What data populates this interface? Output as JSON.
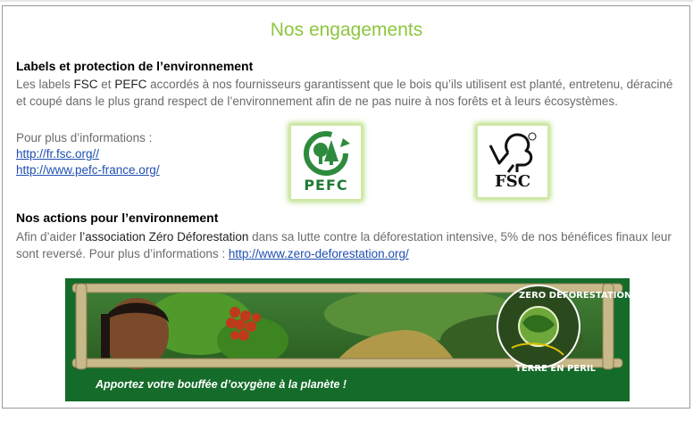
{
  "title": "Nos engagements",
  "section1": {
    "heading": "Labels et protection de l’environnement",
    "para_a": "Les labels ",
    "fsc": "FSC",
    "para_b": " et ",
    "pefc": "PEFC",
    "para_c": " accordés à nos fournisseurs garantissent que le bois qu’ils utilisent  est planté, entretenu, déraciné et coupé dans le plus grand respect  de l’environnement afin de ne pas nuire à nos forêts et à leurs écosystèmes.",
    "more_info": "Pour plus d’informations :",
    "link1": "http://fr.fsc.org//",
    "link2": "http://www.pefc-france.org/"
  },
  "logos": {
    "pefc_label": "PEFC",
    "fsc_label": "FSC"
  },
  "section2": {
    "heading": "Nos actions pour l’environnement",
    "para_a": "Afin d’aider ",
    "assoc": "l’association Zéro Déforestation",
    "para_b": " dans sa lutte contre la déforestation intensive, 5% de nos bénéfices finaux leur sont reversé. Pour plus d’informations :  ",
    "link": "http://www.zero-deforestation.org/"
  },
  "banner": {
    "caption": "Apportez votre bouffée d’oxygène à la planète !",
    "badge_top": "ZERO DEFORESTATION",
    "badge_bottom": "TERRE EN PERIL"
  },
  "colors": {
    "title_green": "#8cc63f",
    "link_blue": "#1f4fb0",
    "banner_green": "#146b2a"
  }
}
